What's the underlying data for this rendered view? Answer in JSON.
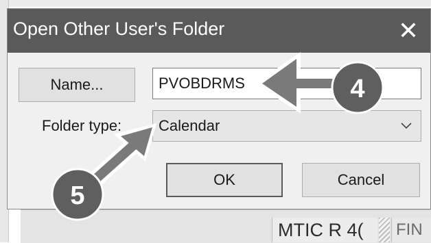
{
  "dialog": {
    "title": "Open Other User's Folder",
    "close_glyph": "✕",
    "name_button_label": "Name...",
    "name_value": "PVOBDRMS",
    "folder_type_label": "Folder type:",
    "folder_type_value": "Calendar",
    "ok_label": "OK",
    "cancel_label": "Cancel"
  },
  "background": {
    "cell_text": "MTIC R 4(",
    "cell2_text": "FIN"
  },
  "callouts": [
    {
      "number": "4",
      "icon": "arrow-left-icon"
    },
    {
      "number": "5",
      "icon": "arrow-up-right-icon"
    }
  ],
  "colors": {
    "titlebar": "#5a5a5a",
    "callout_fill": "#5f5f5f",
    "arrow": "#7a7a7a"
  }
}
